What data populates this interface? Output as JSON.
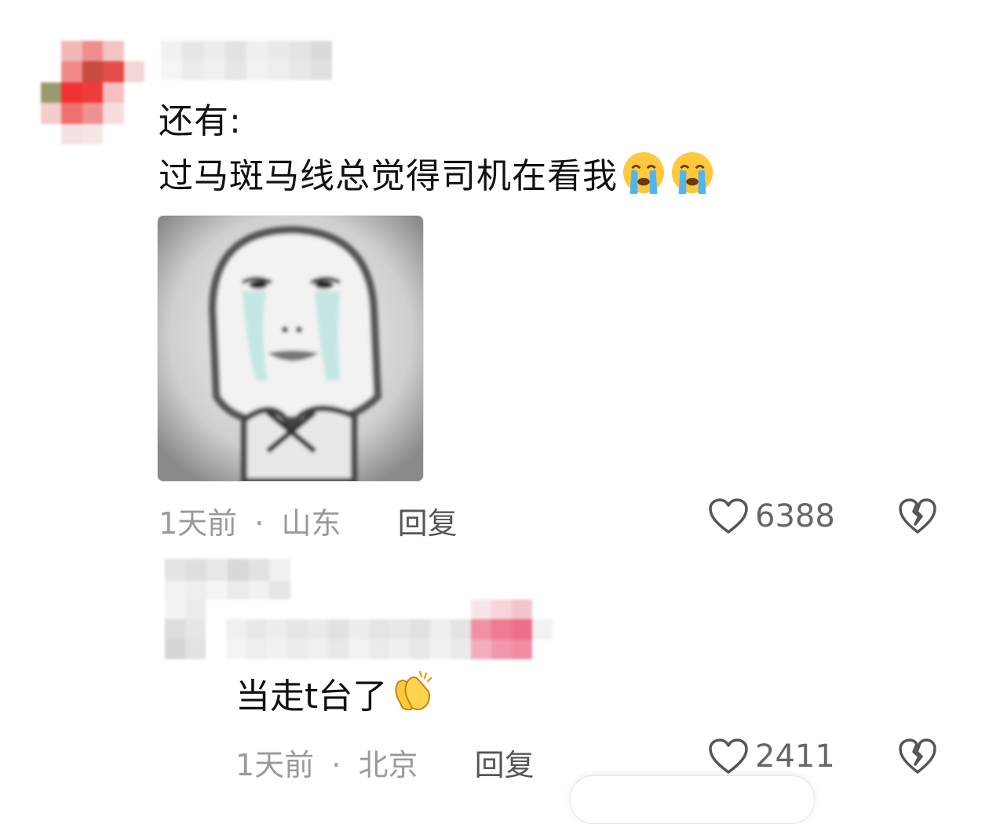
{
  "comment": {
    "text_line1": "还有:",
    "text_line2": "过马斑马线总觉得司机在看我",
    "emojis": [
      "loudly-crying-face",
      "loudly-crying-face"
    ],
    "sticker": "crying-meme-face-sticker",
    "time": "1天前",
    "separator": "·",
    "location": "山东",
    "reply_label": "回复",
    "likes": "6388"
  },
  "reply": {
    "text": "当走t台了",
    "emoji": "clapping-hands",
    "time": "1天前",
    "separator": "·",
    "location": "北京",
    "reply_label": "回复",
    "likes": "2411"
  },
  "colors": {
    "meta_gray": "#9a9a9a",
    "reply_gray": "#555555",
    "like_gray": "#666666",
    "mosaic_red": "#e8343a",
    "mosaic_pink": "#f06a86"
  }
}
